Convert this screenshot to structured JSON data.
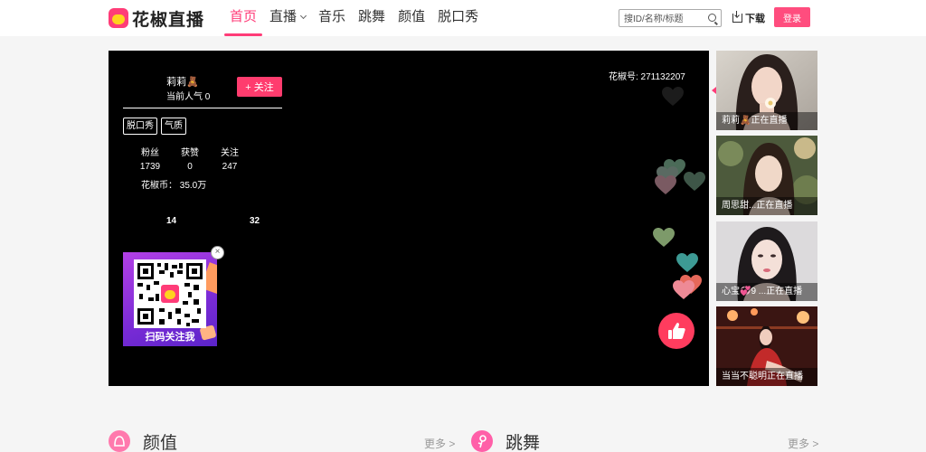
{
  "header": {
    "logo_text": "花椒直播",
    "nav": [
      {
        "label": "首页",
        "active": true
      },
      {
        "label": "直播",
        "has_dropdown": true
      },
      {
        "label": "音乐"
      },
      {
        "label": "跳舞"
      },
      {
        "label": "颜值"
      },
      {
        "label": "脱口秀"
      }
    ],
    "search_placeholder": "搜ID/名称/标题",
    "download_label": "下载",
    "login_label": "登录",
    "accent_color": "#ff3c78"
  },
  "player": {
    "anchor_name": "莉莉🧸",
    "popularity": "当前人气 0",
    "follow_label": "+ 关注",
    "tags": [
      "脱口秀",
      "气质"
    ],
    "stats": [
      {
        "label": "粉丝",
        "value": "1739"
      },
      {
        "label": "获赞",
        "value": "0"
      },
      {
        "label": "关注",
        "value": "247"
      }
    ],
    "coin": "花椒币： 35.0万",
    "extra_left": "14",
    "extra_right": "32",
    "room_id": "花椒号: 271132207",
    "qr_label": "扫码关注我",
    "close_glyph": "×"
  },
  "recommend": [
    {
      "caption": "莉莉🧸正在直播",
      "active": true
    },
    {
      "caption": "周思甜...正在直播"
    },
    {
      "caption": "心宝💞9 ...正在直播"
    },
    {
      "caption": "当当不聪明正在直播"
    }
  ],
  "sections": [
    {
      "title": "颜值",
      "more": "更多 >",
      "icon_color": "#ff79ad"
    },
    {
      "title": "跳舞",
      "more": "更多 >",
      "icon_color": "#ff5fa8"
    }
  ]
}
